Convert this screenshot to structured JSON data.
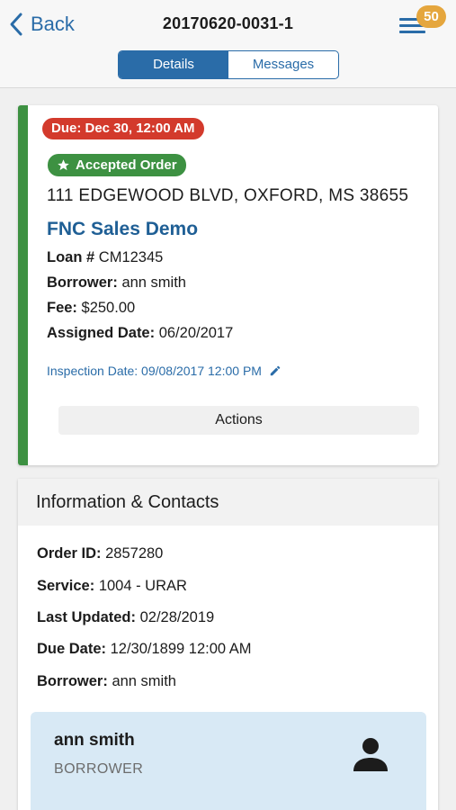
{
  "header": {
    "back_label": "Back",
    "title": "20170620-0031-1",
    "notification_count": "50",
    "tabs": [
      {
        "label": "Details",
        "active": true
      },
      {
        "label": "Messages",
        "active": false
      }
    ]
  },
  "order": {
    "due_badge": "Due: Dec 30, 12:00 AM",
    "status_badge": "Accepted Order",
    "address": "111 EDGEWOOD BLVD, OXFORD, MS 38655",
    "client": "FNC Sales Demo",
    "fields": [
      {
        "label": "Loan #",
        "value": "CM12345"
      },
      {
        "label": "Borrower:",
        "value": "ann smith"
      },
      {
        "label": "Fee:",
        "value": "$250.00"
      },
      {
        "label": "Assigned Date:",
        "value": "06/20/2017"
      }
    ],
    "inspection": "Inspection Date: 09/08/2017 12:00 PM",
    "actions_label": "Actions"
  },
  "info": {
    "title": "Information & Contacts",
    "fields": [
      {
        "label": "Order ID:",
        "value": "2857280"
      },
      {
        "label": "Service:",
        "value": "1004 - URAR"
      },
      {
        "label": "Last Updated:",
        "value": "02/28/2019"
      },
      {
        "label": "Due Date:",
        "value": "12/30/1899 12:00 AM"
      },
      {
        "label": "Borrower:",
        "value": "ann smith"
      }
    ]
  },
  "contact": {
    "name": "ann smith",
    "role": "BORROWER"
  },
  "colors": {
    "accent": "#2a6ca8",
    "success": "#3d9142",
    "danger": "#d33a2c",
    "badge": "#e5a63d"
  },
  "icons": [
    "chevron-left-icon",
    "hamburger-menu-icon",
    "star-icon",
    "pencil-icon",
    "person-icon"
  ]
}
